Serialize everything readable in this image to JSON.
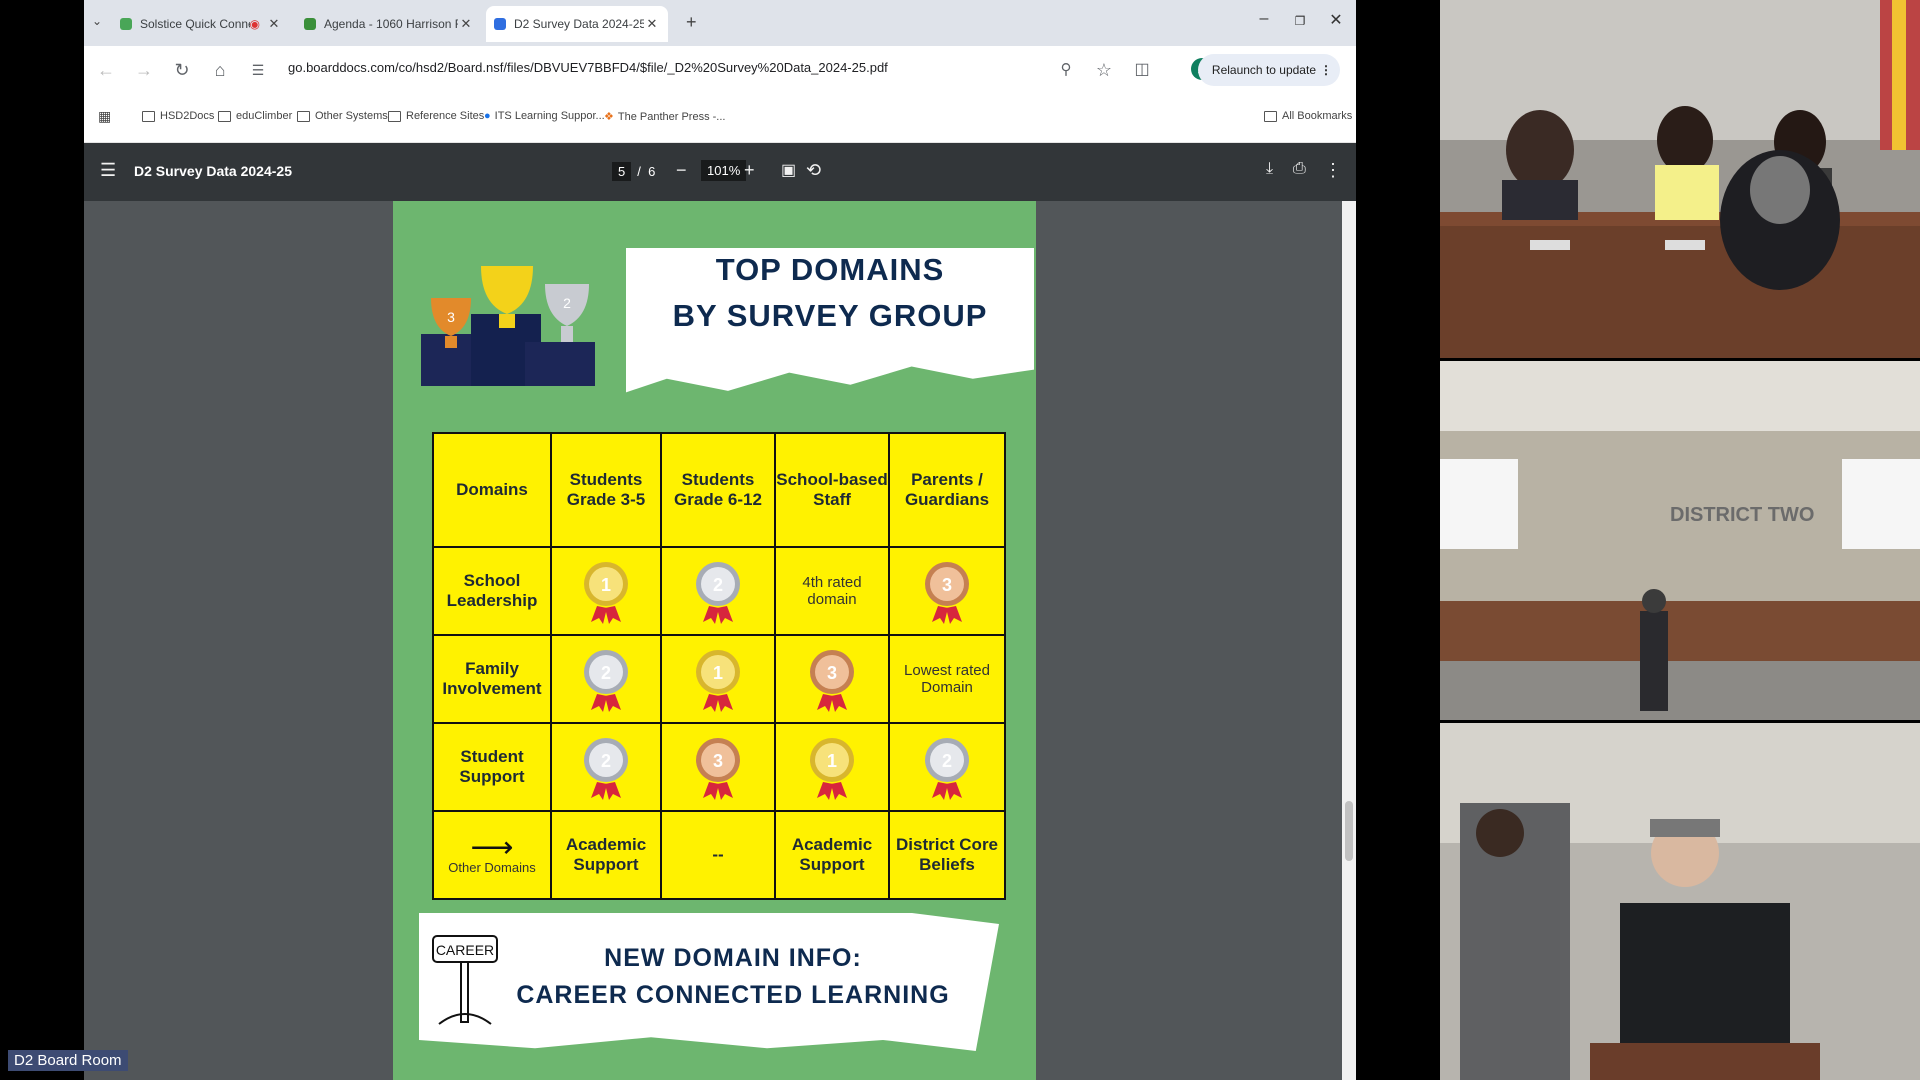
{
  "browser": {
    "tabs": [
      {
        "label": "Solstice Quick Connect",
        "active": false
      },
      {
        "label": "Agenda - 1060 Harrison Ro",
        "active": false
      },
      {
        "label": "D2 Survey Data 2024-25",
        "active": true
      }
    ],
    "new_tab": "+",
    "url": "go.boarddocs.com/co/hsd2/Board.nsf/files/DBVUEV7BBFD4/$file/_D2%20Survey%20Data_2024-25.pdf",
    "relaunch_label": "Relaunch to update",
    "avatar_letter": "A",
    "bookmarks": [
      "HSD2Docs",
      "eduClimber",
      "Other Systems",
      "Reference Sites",
      "ITS Learning Suppor...",
      "The Panther Press -..."
    ],
    "all_bookmarks": "All Bookmarks"
  },
  "pdf": {
    "title": "D2 Survey Data 2024-25",
    "page_current": "5",
    "page_total": "6",
    "page_sep": "/",
    "zoom": "101%"
  },
  "slide": {
    "title_line1": "TOP DOMAINS",
    "title_line2": "BY SURVEY GROUP",
    "headers": [
      "Domains",
      "Students Grade 3-5",
      "Students Grade 6-12",
      "School-based Staff",
      "Parents / Guardians"
    ],
    "rows": [
      {
        "domain": "School Leadership",
        "cells": [
          {
            "type": "medal",
            "rank": "1",
            "color": "gold"
          },
          {
            "type": "medal",
            "rank": "2",
            "color": "silver"
          },
          {
            "type": "text",
            "text": "4th rated domain"
          },
          {
            "type": "medal",
            "rank": "3",
            "color": "bronze"
          }
        ]
      },
      {
        "domain": "Family Involvement",
        "cells": [
          {
            "type": "medal",
            "rank": "2",
            "color": "silver"
          },
          {
            "type": "medal",
            "rank": "1",
            "color": "gold"
          },
          {
            "type": "medal",
            "rank": "3",
            "color": "bronze"
          },
          {
            "type": "text",
            "text": "Lowest rated Domain"
          }
        ]
      },
      {
        "domain": "Student Support",
        "cells": [
          {
            "type": "medal",
            "rank": "2",
            "color": "silver"
          },
          {
            "type": "medal",
            "rank": "3",
            "color": "bronze"
          },
          {
            "type": "medal",
            "rank": "1",
            "color": "gold"
          },
          {
            "type": "medal",
            "rank": "2",
            "color": "silver"
          }
        ]
      }
    ],
    "other_row": {
      "label": "Other Domains",
      "cells": [
        "Academic Support",
        "--",
        "Academic Support",
        "District Core Beliefs"
      ]
    },
    "career_sign": "CAREER",
    "career_line1": "NEW DOMAIN INFO:",
    "career_line2": "CAREER CONNECTED LEARNING"
  },
  "video": {
    "room_label": "D2 Board Room",
    "wall_sign": "DISTRICT TWO"
  },
  "colors": {
    "slide_green": "#6db66f",
    "table_yellow": "#fff200",
    "title_navy": "#0e2a4f"
  }
}
